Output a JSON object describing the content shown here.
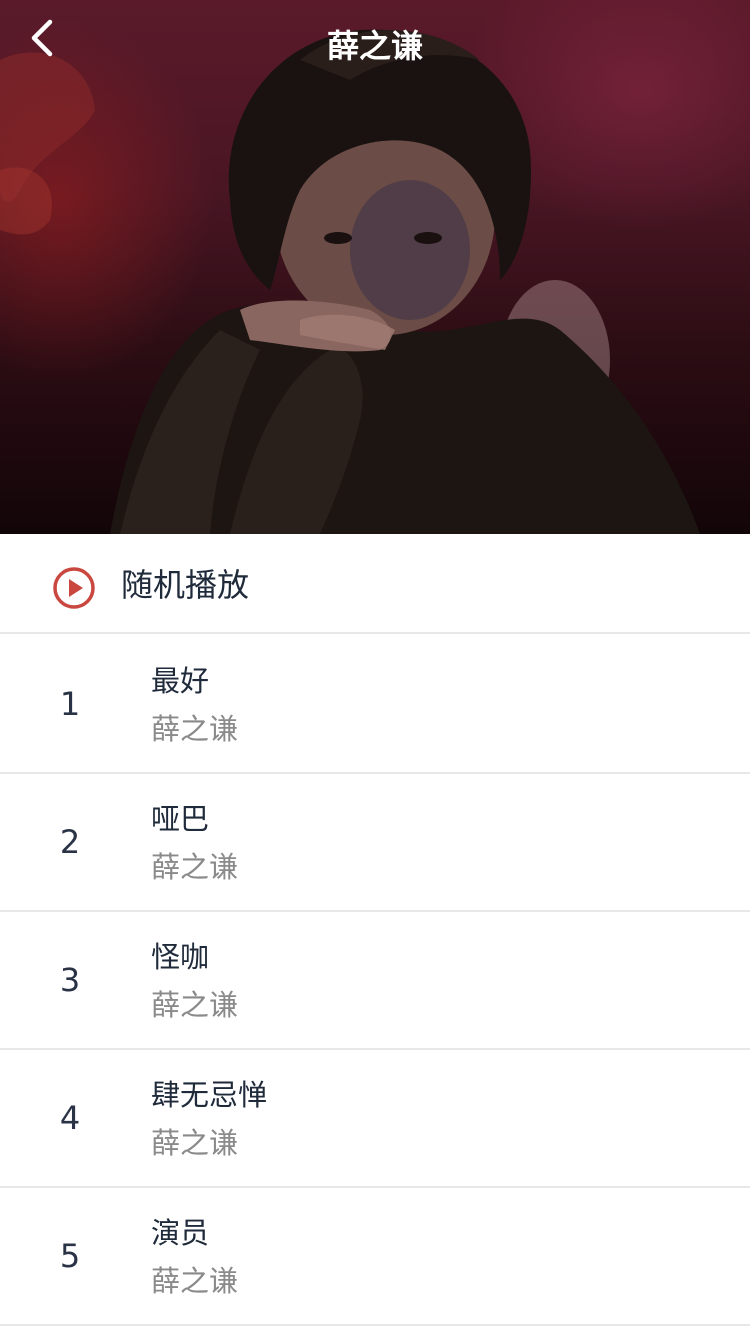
{
  "header": {
    "title": "薛之谦",
    "back_icon": "chevron-left-icon"
  },
  "hero": {
    "image": "artist-cover-photo"
  },
  "shuffle": {
    "icon": "play-circle-icon",
    "label": "随机播放",
    "accent_color": "#c9473f"
  },
  "songs": [
    {
      "index": "1",
      "title": "最好",
      "artist": "薛之谦"
    },
    {
      "index": "2",
      "title": "哑巴",
      "artist": "薛之谦"
    },
    {
      "index": "3",
      "title": "怪咖",
      "artist": "薛之谦"
    },
    {
      "index": "4",
      "title": "肆无忌惮",
      "artist": "薛之谦"
    },
    {
      "index": "5",
      "title": "演员",
      "artist": "薛之谦"
    }
  ]
}
